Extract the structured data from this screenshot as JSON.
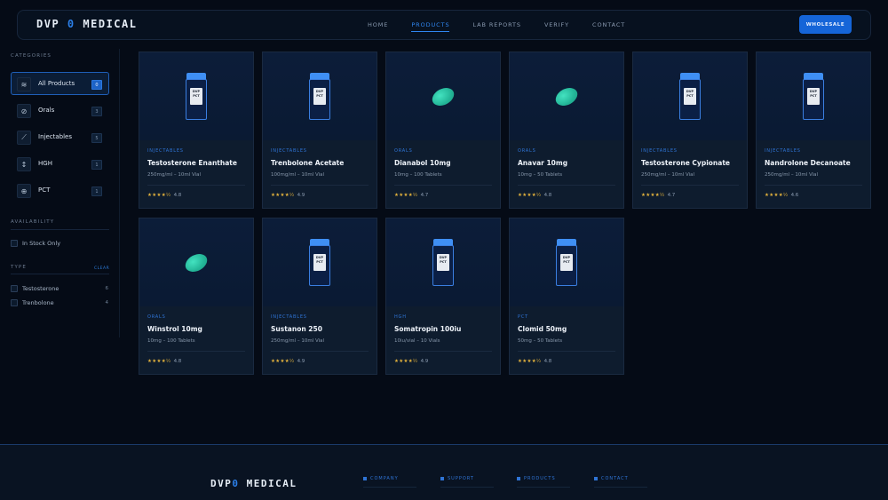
{
  "header": {
    "logo_left": "DVP",
    "logo_mid": "0",
    "logo_right": "MEDICAL",
    "nav": [
      "HOME",
      "PRODUCTS",
      "LAB REPORTS",
      "VERIFY",
      "CONTACT"
    ],
    "active_nav": "PRODUCTS",
    "wholesale_label": "WHOLESALE"
  },
  "sidebar": {
    "categories_title": "CATEGORIES",
    "categories": [
      {
        "label": "All Products",
        "count": "0",
        "icon": "layers-icon"
      },
      {
        "label": "Orals",
        "count": "3",
        "icon": "pill-icon"
      },
      {
        "label": "Injectables",
        "count": "5",
        "icon": "syringe-icon"
      },
      {
        "label": "HGH",
        "count": "1",
        "icon": "arrows-vertical-icon"
      },
      {
        "label": "PCT",
        "count": "1",
        "icon": "plus-circle-icon"
      }
    ],
    "availability_title": "AVAILABILITY",
    "in_stock_label": "In Stock Only",
    "type_title": "TYPE",
    "clear_label": "CLEAR",
    "types": [
      {
        "label": "Testosterone",
        "count": "6"
      },
      {
        "label": "Trenbolone",
        "count": "4"
      }
    ]
  },
  "vial_label": {
    "line1": "DVP",
    "line2": "PCT"
  },
  "products": [
    {
      "category": "INJECTABLES",
      "name": "Testosterone Enanthate",
      "size": "250mg/ml – 10ml Vial",
      "stars": "★★★★½",
      "rating": "4.8",
      "image": "vial"
    },
    {
      "category": "INJECTABLES",
      "name": "Trenbolone Acetate",
      "size": "100mg/ml – 10ml Vial",
      "stars": "★★★★½",
      "rating": "4.9",
      "image": "vial"
    },
    {
      "category": "ORALS",
      "name": "Dianabol 10mg",
      "size": "10mg – 100 Tablets",
      "stars": "★★★★½",
      "rating": "4.7",
      "image": "pill"
    },
    {
      "category": "ORALS",
      "name": "Anavar 10mg",
      "size": "10mg – 50 Tablets",
      "stars": "★★★★½",
      "rating": "4.8",
      "image": "pill"
    },
    {
      "category": "INJECTABLES",
      "name": "Testosterone Cypionate",
      "size": "250mg/ml – 10ml Vial",
      "stars": "★★★★½",
      "rating": "4.7",
      "image": "vial"
    },
    {
      "category": "INJECTABLES",
      "name": "Nandrolone Decanoate",
      "size": "250mg/ml – 10ml Vial",
      "stars": "★★★★½",
      "rating": "4.6",
      "image": "vial"
    },
    {
      "category": "ORALS",
      "name": "Winstrol 10mg",
      "size": "10mg – 100 Tablets",
      "stars": "★★★★½",
      "rating": "4.8",
      "image": "pill"
    },
    {
      "category": "INJECTABLES",
      "name": "Sustanon 250",
      "size": "250mg/ml – 10ml Vial",
      "stars": "★★★★½",
      "rating": "4.9",
      "image": "vial"
    },
    {
      "category": "HGH",
      "name": "Somatropin 100iu",
      "size": "10iu/vial – 10 Vials",
      "stars": "★★★★½",
      "rating": "4.9",
      "image": "vial"
    },
    {
      "category": "PCT",
      "name": "Clomid 50mg",
      "size": "50mg – 50 Tablets",
      "stars": "★★★★½",
      "rating": "4.8",
      "image": "vial"
    }
  ],
  "footer": {
    "logo_left": "DVP",
    "logo_mid": "0",
    "logo_right": "MEDICAL",
    "columns": [
      "COMPANY",
      "SUPPORT",
      "PRODUCTS",
      "CONTACT"
    ]
  },
  "colors": {
    "accent": "#1565d8",
    "background": "#050b16",
    "pill": "#2fc9a6",
    "star": "#e3b23c"
  }
}
